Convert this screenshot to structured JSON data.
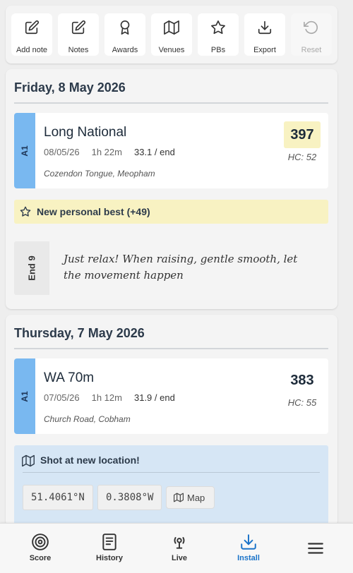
{
  "toolbar": {
    "buttons": [
      {
        "label": "Add note",
        "icon": "edit-icon"
      },
      {
        "label": "Notes",
        "icon": "edit-icon"
      },
      {
        "label": "Awards",
        "icon": "award-icon"
      },
      {
        "label": "Venues",
        "icon": "map-icon"
      },
      {
        "label": "PBs",
        "icon": "star-icon"
      },
      {
        "label": "Export",
        "icon": "download-icon"
      },
      {
        "label": "Reset",
        "icon": "undo-icon",
        "disabled": true
      }
    ]
  },
  "days": [
    {
      "title": "Friday, 8 May 2026",
      "round": {
        "tag": "A1",
        "name": "Long National",
        "date": "08/05/26",
        "duration": "1h 22m",
        "avg": "33.1 / end",
        "location": "Cozendon Tongue, Meopham",
        "score": "397",
        "hc": "HC: 52",
        "is_pb": true
      },
      "pb_banner": "New personal best (+49)",
      "note": {
        "end": "End 9",
        "text": "Just relax! When raising, gentle smooth, let the movement happen"
      }
    },
    {
      "title": "Thursday, 7 May 2026",
      "round": {
        "tag": "A1",
        "name": "WA 70m",
        "date": "07/05/26",
        "duration": "1h 12m",
        "avg": "31.9 / end",
        "location": "Church Road, Cobham",
        "score": "383",
        "hc": "HC: 55",
        "is_pb": false
      },
      "location_banner": {
        "title": "Shot at new location!",
        "lat": "51.4061°N",
        "lon": "0.3808°W",
        "map_label": "Map"
      }
    }
  ],
  "nav": [
    {
      "label": "Score",
      "icon": "target-icon"
    },
    {
      "label": "History",
      "icon": "history-icon"
    },
    {
      "label": "Live",
      "icon": "broadcast-icon"
    },
    {
      "label": "Install",
      "icon": "install-icon",
      "active": true
    },
    {
      "label": "",
      "icon": "menu-icon"
    }
  ],
  "colors": {
    "accent": "#1a73c9",
    "round_tab": "#79b8f0",
    "pb_yellow": "#f8f2c2",
    "location_blue": "#d6e6f5"
  }
}
